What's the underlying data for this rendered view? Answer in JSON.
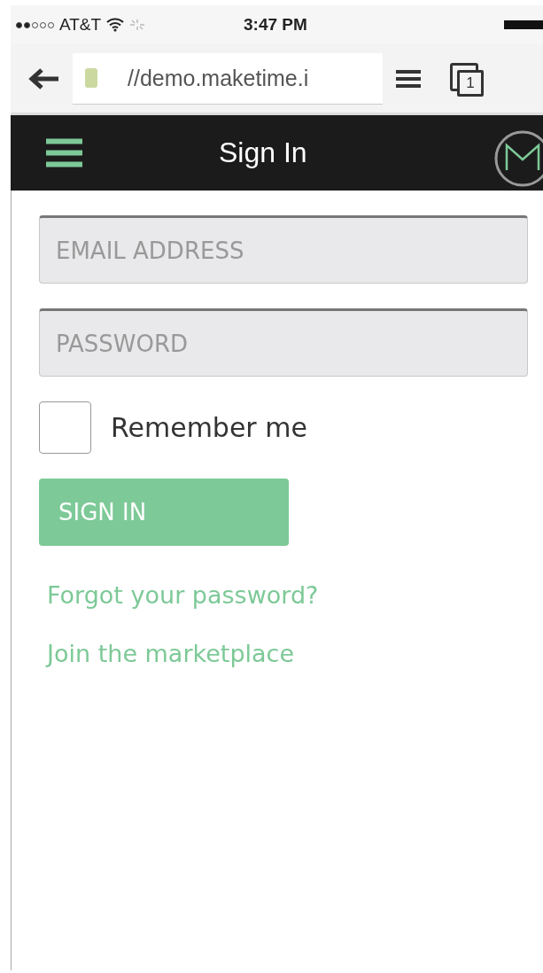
{
  "status_bar": {
    "carrier": "AT&T",
    "time": "3:47 PM"
  },
  "browser": {
    "url": "//demo.maketime.i",
    "tab_count": "1"
  },
  "header": {
    "title": "Sign In"
  },
  "form": {
    "fields": [
      {
        "placeholder": "EMAIL ADDRESS"
      },
      {
        "placeholder": "PASSWORD"
      }
    ],
    "remember": {
      "label": "Remember me",
      "checked": false
    },
    "submit": "SIGN IN",
    "links": [
      "Forgot your password?",
      "Join the marketplace"
    ]
  }
}
